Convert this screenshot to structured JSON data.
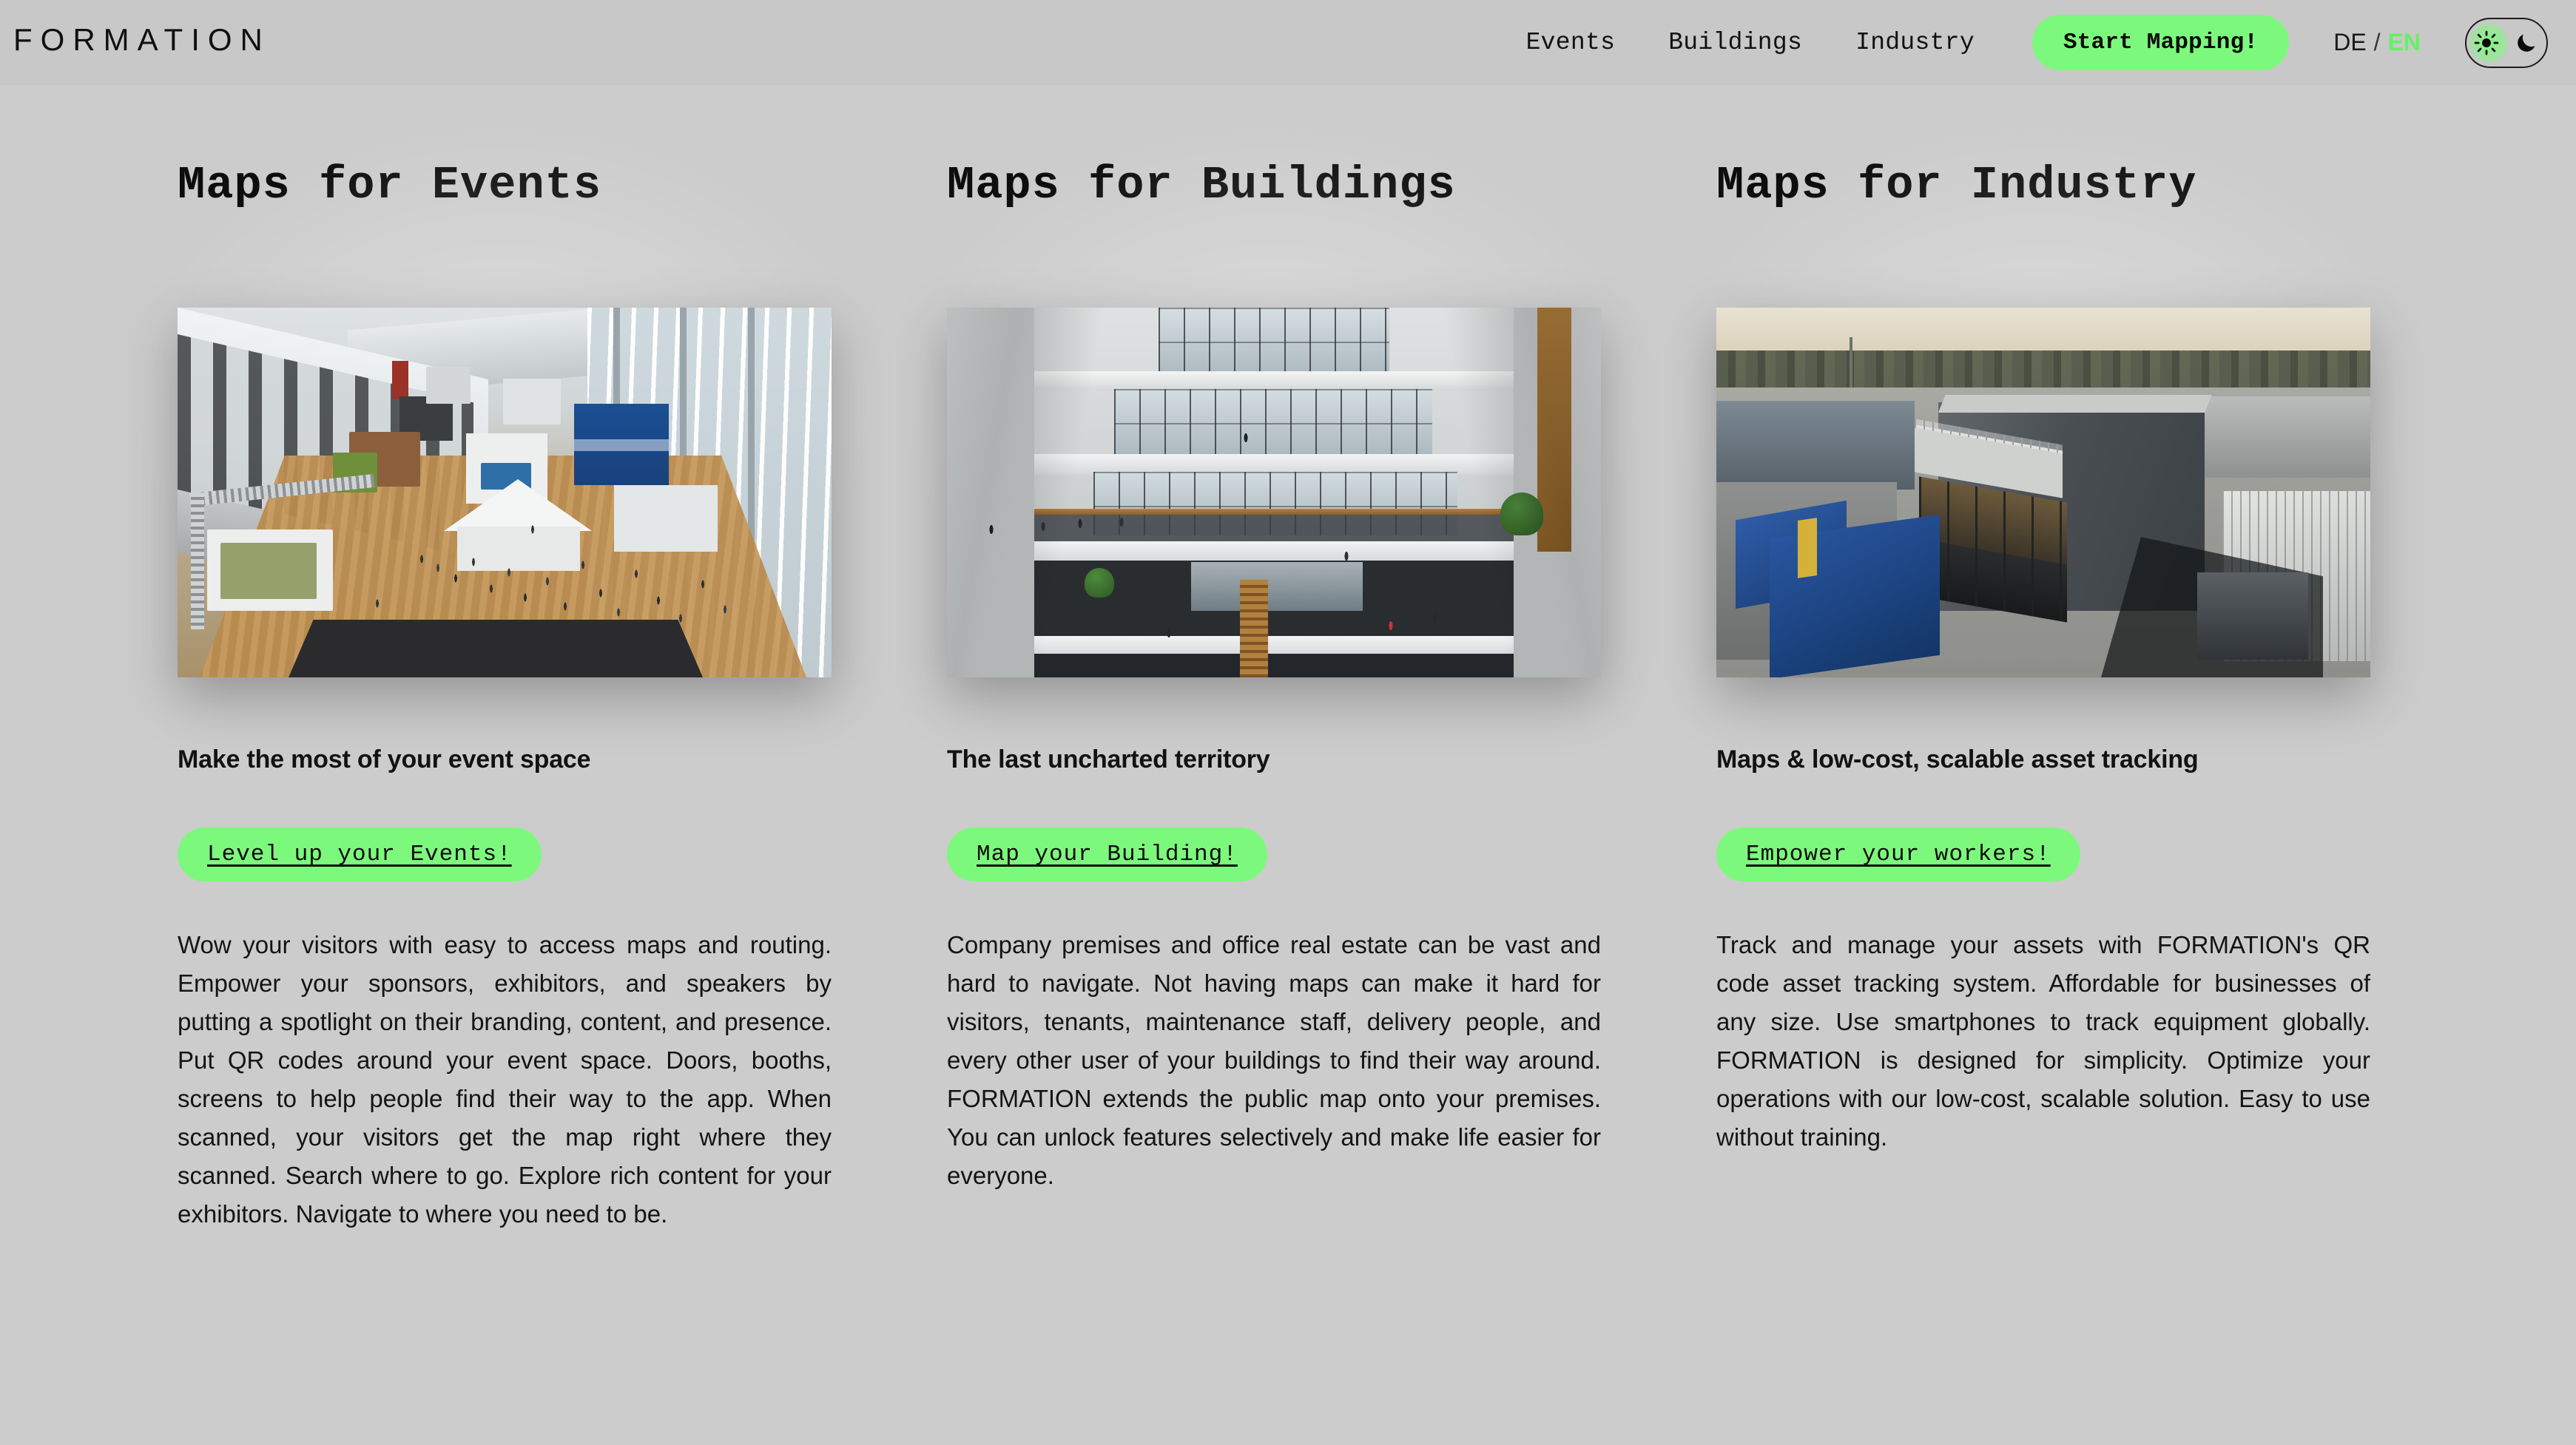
{
  "brand": {
    "logo": "FORMATION"
  },
  "header": {
    "nav": [
      {
        "label": "Events",
        "name": "nav-link-events"
      },
      {
        "label": "Buildings",
        "name": "nav-link-buildings"
      },
      {
        "label": "Industry",
        "name": "nav-link-industry"
      }
    ],
    "cta_label": "Start Mapping!",
    "language": {
      "de": "DE",
      "separator": "/",
      "en": "EN",
      "active": "EN",
      "active_color": "#63f263"
    },
    "theme_toggle": {
      "light_icon": "sun-icon",
      "dark_icon": "moon-icon",
      "active": "light"
    }
  },
  "colors": {
    "accent_green": "#7cf97c",
    "page_background": "#cccccc",
    "header_background": "#c8c8c8",
    "text": "#121212"
  },
  "columns": [
    {
      "title": "Maps for Events",
      "image_alt": "exhibition-hall-trade-show",
      "subtitle": "Make the most of your event space",
      "button_label": "Level up your Events!",
      "body": "Wow your visitors with easy to access maps and routing. Empower your sponsors, exhibitors, and speakers by putting a spotlight on their branding, content, and presence. Put QR codes around your event space. Doors, booths, screens to help people find their way to the app. When scanned, your visitors get the map right where they scanned. Search where to go. Explore rich content for your exhibitors. Navigate to where you need to be."
    },
    {
      "title": "Maps for Buildings",
      "image_alt": "office-atrium-interior",
      "subtitle": "The last uncharted territory",
      "button_label": "Map your Building!",
      "body": "Company premises and office real estate can be vast and hard to navigate. Not having maps can make it hard for visitors, tenants, maintenance staff, delivery people, and every other user of your buildings to find their way around. FORMATION extends the public map onto your premises. You can unlock features selectively and make life easier for everyone."
    },
    {
      "title": "Maps for Industry",
      "image_alt": "industrial-facility-aerial",
      "subtitle": "Maps & low-cost, scalable asset tracking",
      "button_label": "Empower your workers!",
      "body": "Track and manage your assets with FORMATION's QR code asset tracking system. Affordable for businesses of any size. Use smartphones to track equipment globally. FORMATION is designed for simplicity. Optimize your operations with our low-cost, scalable solution. Easy to use without training."
    }
  ]
}
